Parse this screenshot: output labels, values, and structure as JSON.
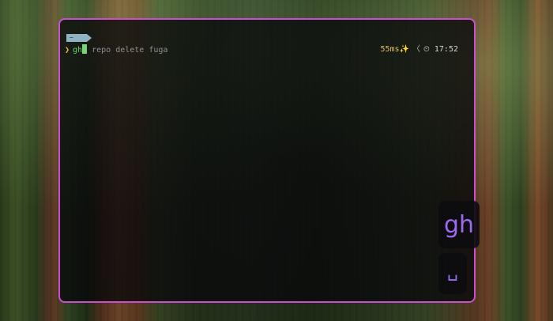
{
  "prompt": {
    "directory": "~",
    "chevron": "❯",
    "command": "gh",
    "arguments": " repo delete fuga"
  },
  "right_prompt": {
    "duration": "55ms✨",
    "separator": "〈",
    "clock_icon": "clock-icon",
    "time": "17:52"
  },
  "key_overlay": {
    "keys": [
      "gh",
      "␣"
    ]
  },
  "colors": {
    "window_border": "#c94fd0",
    "key_text": "#9b6cf0",
    "command": "#6fcf6f",
    "duration": "#e2c15a"
  }
}
